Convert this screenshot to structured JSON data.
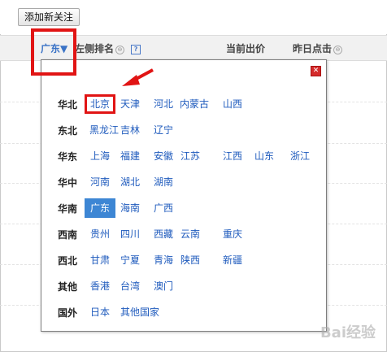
{
  "toolbar": {
    "add_follow_label": "添加新关注"
  },
  "columns": {
    "region_filter": "广东▼",
    "rank": "左侧排名",
    "rank_help": "?",
    "current_bid": "当前出价",
    "yesterday_clicks": "昨日点击"
  },
  "popup": {
    "close_label": "✕",
    "regions": [
      {
        "label": "华北",
        "cities": [
          "北京",
          "天津",
          "河北",
          "内蒙古",
          "山西"
        ]
      },
      {
        "label": "东北",
        "cities": [
          "黑龙江",
          "吉林",
          "辽宁"
        ]
      },
      {
        "label": "华东",
        "cities": [
          "上海",
          "福建",
          "安徽",
          "江苏",
          "江西",
          "山东",
          "浙江"
        ]
      },
      {
        "label": "华中",
        "cities": [
          "河南",
          "湖北",
          "湖南"
        ]
      },
      {
        "label": "华南",
        "cities": [
          "广东",
          "海南",
          "广西"
        ]
      },
      {
        "label": "西南",
        "cities": [
          "贵州",
          "四川",
          "西藏",
          "云南",
          "重庆"
        ]
      },
      {
        "label": "西北",
        "cities": [
          "甘肃",
          "宁夏",
          "青海",
          "陕西",
          "新疆"
        ]
      },
      {
        "label": "其他",
        "cities": [
          "香港",
          "台湾",
          "澳门"
        ]
      },
      {
        "label": "国外",
        "cities": [
          "日本",
          "其他国家"
        ]
      }
    ],
    "selected_city": "广东",
    "annotated_city": "北京"
  },
  "colors": {
    "accent": "#3d86d4",
    "annotation": "#e11414",
    "link": "#1f5bbd"
  },
  "watermark": "Bai经验"
}
